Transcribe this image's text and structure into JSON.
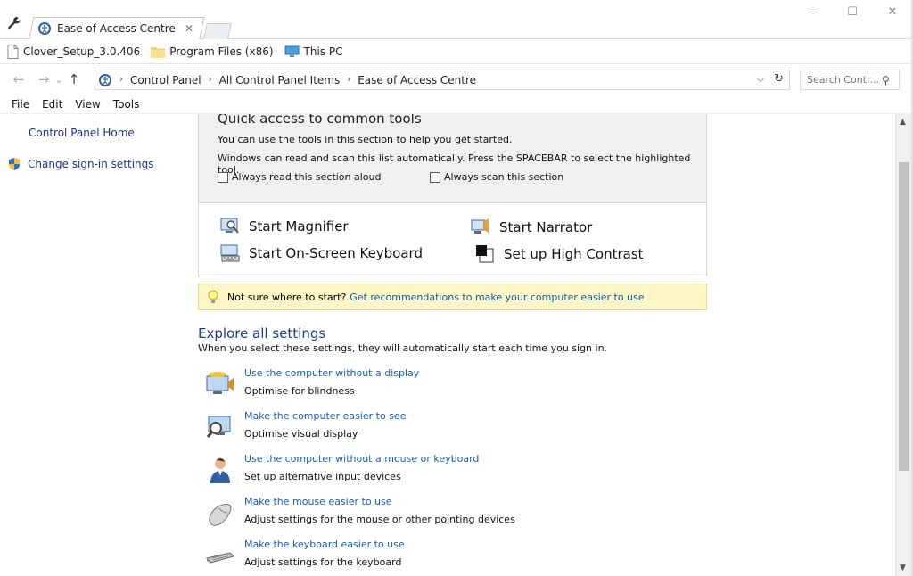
{
  "tab": {
    "title": "Ease of Access Centre",
    "close": "✕"
  },
  "window": {
    "minimize": "—",
    "maximize": "☐",
    "close": "✕"
  },
  "favorites": [
    {
      "label": "Clover_Setup_3.0.406",
      "icon": "file-icon"
    },
    {
      "label": "Program Files (x86)",
      "icon": "folder-icon"
    },
    {
      "label": "This PC",
      "icon": "computer-icon"
    }
  ],
  "nav": {
    "back": "←",
    "forward": "→",
    "history": "⌄",
    "up": "↑"
  },
  "address": {
    "crumbs": [
      "Control Panel",
      "All Control Panel Items",
      "Ease of Access Centre"
    ],
    "sep": "›",
    "dropdown": "⌵",
    "refresh": "↻"
  },
  "search": {
    "placeholder": "Search Contr...",
    "icon": "⚲"
  },
  "menu": [
    "File",
    "Edit",
    "View",
    "Tools"
  ],
  "left_panel": {
    "home": "Control Panel Home",
    "signin": "Change sign-in settings"
  },
  "quick_access": {
    "title": "Quick access to common tools",
    "line1": "You can use the tools in this section to help you get started.",
    "line2": "Windows can read and scan this list automatically.  Press the SPACEBAR to select the highlighted tool.",
    "check_read": "Always read this section aloud",
    "check_scan": "Always scan this section",
    "tools": {
      "magnifier": "Start Magnifier",
      "narrator": "Start Narrator",
      "keyboard": "Start On-Screen Keyboard",
      "contrast": "Set up High Contrast"
    }
  },
  "tip": {
    "text": "Not sure where to start?",
    "link": "Get recommendations to make your computer easier to use"
  },
  "explore": {
    "title": "Explore all settings",
    "subtitle": "When you select these settings, they will automatically start each time you sign in.",
    "items": [
      {
        "link": "Use the computer without a display",
        "desc": "Optimise for blindness",
        "icon": "monitor-speaker-icon"
      },
      {
        "link": "Make the computer easier to see",
        "desc": "Optimise visual display",
        "icon": "monitor-magnifier-icon"
      },
      {
        "link": "Use the computer without a mouse or keyboard",
        "desc": "Set up alternative input devices",
        "icon": "person-icon"
      },
      {
        "link": "Make the mouse easier to use",
        "desc": "Adjust settings for the mouse or other pointing devices",
        "icon": "mouse-icon"
      },
      {
        "link": "Make the keyboard easier to use",
        "desc": "Adjust settings for the keyboard",
        "icon": "keyboard-icon"
      }
    ]
  },
  "scrollbar": {
    "up": "▲",
    "down": "▼"
  }
}
